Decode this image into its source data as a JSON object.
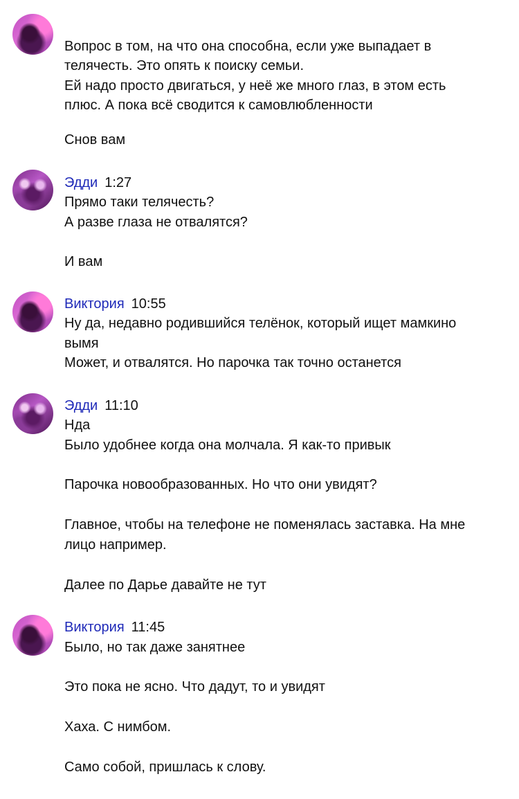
{
  "messages": [
    {
      "author": "",
      "time": "",
      "lines": [
        "Вопрос в том, на что она способна, если уже выпадает в",
        "телячесть. Это опять к поиску семьи.",
        "Ей надо просто двигаться, у неё же много глаз, в этом есть",
        "плюс. А пока всё сводится к самовлюбленности",
        "Снов вам"
      ]
    },
    {
      "author": "Эдди",
      "time": "1:27",
      "lines": [
        "Прямо таки телячесть?",
        "А разве глаза не отвалятся?",
        "И вам"
      ]
    },
    {
      "author": "Виктория",
      "time": "10:55",
      "lines": [
        "Ну да, недавно родившийся телёнок, который ищет мамкино",
        "вымя",
        "Может, и отвалятся. Но парочка так точно останется"
      ]
    },
    {
      "author": "Эдди",
      "time": "11:10",
      "lines": [
        "Нда",
        "Было удобнее когда она молчала. Я как-то привык",
        "Парочка новообразованных. Но что они увидят?",
        "Главное, чтобы на телефоне не поменялась заставка. На мне",
        "лицо например.",
        "Далее по Дарье давайте не тут"
      ]
    },
    {
      "author": "Виктория",
      "time": "11:45",
      "lines": [
        "Было, но так даже занятнее",
        "Это пока не ясно. Что дадут, то и увидят",
        "Хаха. С нимбом.",
        "Само собой, пришлась к слову."
      ]
    }
  ]
}
